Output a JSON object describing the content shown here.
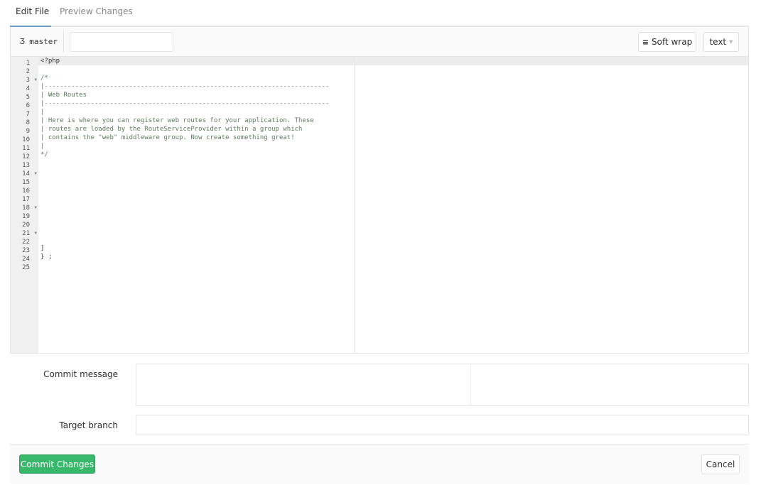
{
  "tabs": [
    {
      "label": "Edit File",
      "active": true
    },
    {
      "label": "Preview Changes",
      "active": false
    }
  ],
  "toolbar": {
    "branch": "master",
    "branch_icon": "git-branch-icon",
    "file_name": "",
    "soft_wrap_label": "Soft wrap",
    "soft_wrap_icon": "wrap-icon",
    "mode": "text"
  },
  "editor": {
    "lines": [
      {
        "n": "1",
        "text": "<?php",
        "fold": false,
        "plain": true
      },
      {
        "n": "2",
        "text": "",
        "fold": false
      },
      {
        "n": "3",
        "text": "/*",
        "fold": true
      },
      {
        "n": "4",
        "text": "|--------------------------------------------------------------------------",
        "fold": false
      },
      {
        "n": "5",
        "text": "| Web Routes",
        "fold": false
      },
      {
        "n": "6",
        "text": "|--------------------------------------------------------------------------",
        "fold": false
      },
      {
        "n": "7",
        "text": "|",
        "fold": false
      },
      {
        "n": "8",
        "text": "| Here is where you can register web routes for your application. These",
        "fold": false
      },
      {
        "n": "9",
        "text": "| routes are loaded by the RouteServiceProvider within a group which",
        "fold": false
      },
      {
        "n": "10",
        "text": "| contains the \"web\" middleware group. Now create something great!",
        "fold": false
      },
      {
        "n": "11",
        "text": "|",
        "fold": false
      },
      {
        "n": "12",
        "text": "*/",
        "fold": false
      },
      {
        "n": "13",
        "text": "",
        "fold": false
      },
      {
        "n": "14",
        "text": "",
        "fold": true
      },
      {
        "n": "15",
        "text": "",
        "fold": false
      },
      {
        "n": "16",
        "text": "",
        "fold": false
      },
      {
        "n": "17",
        "text": "",
        "fold": false
      },
      {
        "n": "18",
        "text": "",
        "fold": true
      },
      {
        "n": "19",
        "text": "",
        "fold": false
      },
      {
        "n": "20",
        "text": "",
        "fold": false
      },
      {
        "n": "21",
        "text": "",
        "fold": true
      },
      {
        "n": "22",
        "text": "",
        "fold": false
      },
      {
        "n": "23",
        "text": "]",
        "fold": false,
        "plain": true
      },
      {
        "n": "24",
        "text": "} ;",
        "fold": false,
        "plain": true
      },
      {
        "n": "25",
        "text": "",
        "fold": false
      }
    ]
  },
  "form": {
    "commit_message_label": "Commit message",
    "commit_message_value": "",
    "target_branch_label": "Target branch",
    "target_branch_value": ""
  },
  "footer": {
    "commit_label": "Commit Changes",
    "cancel_label": "Cancel"
  },
  "colors": {
    "accent": "#37b86a",
    "tab_underline": "#6b9bc6"
  }
}
